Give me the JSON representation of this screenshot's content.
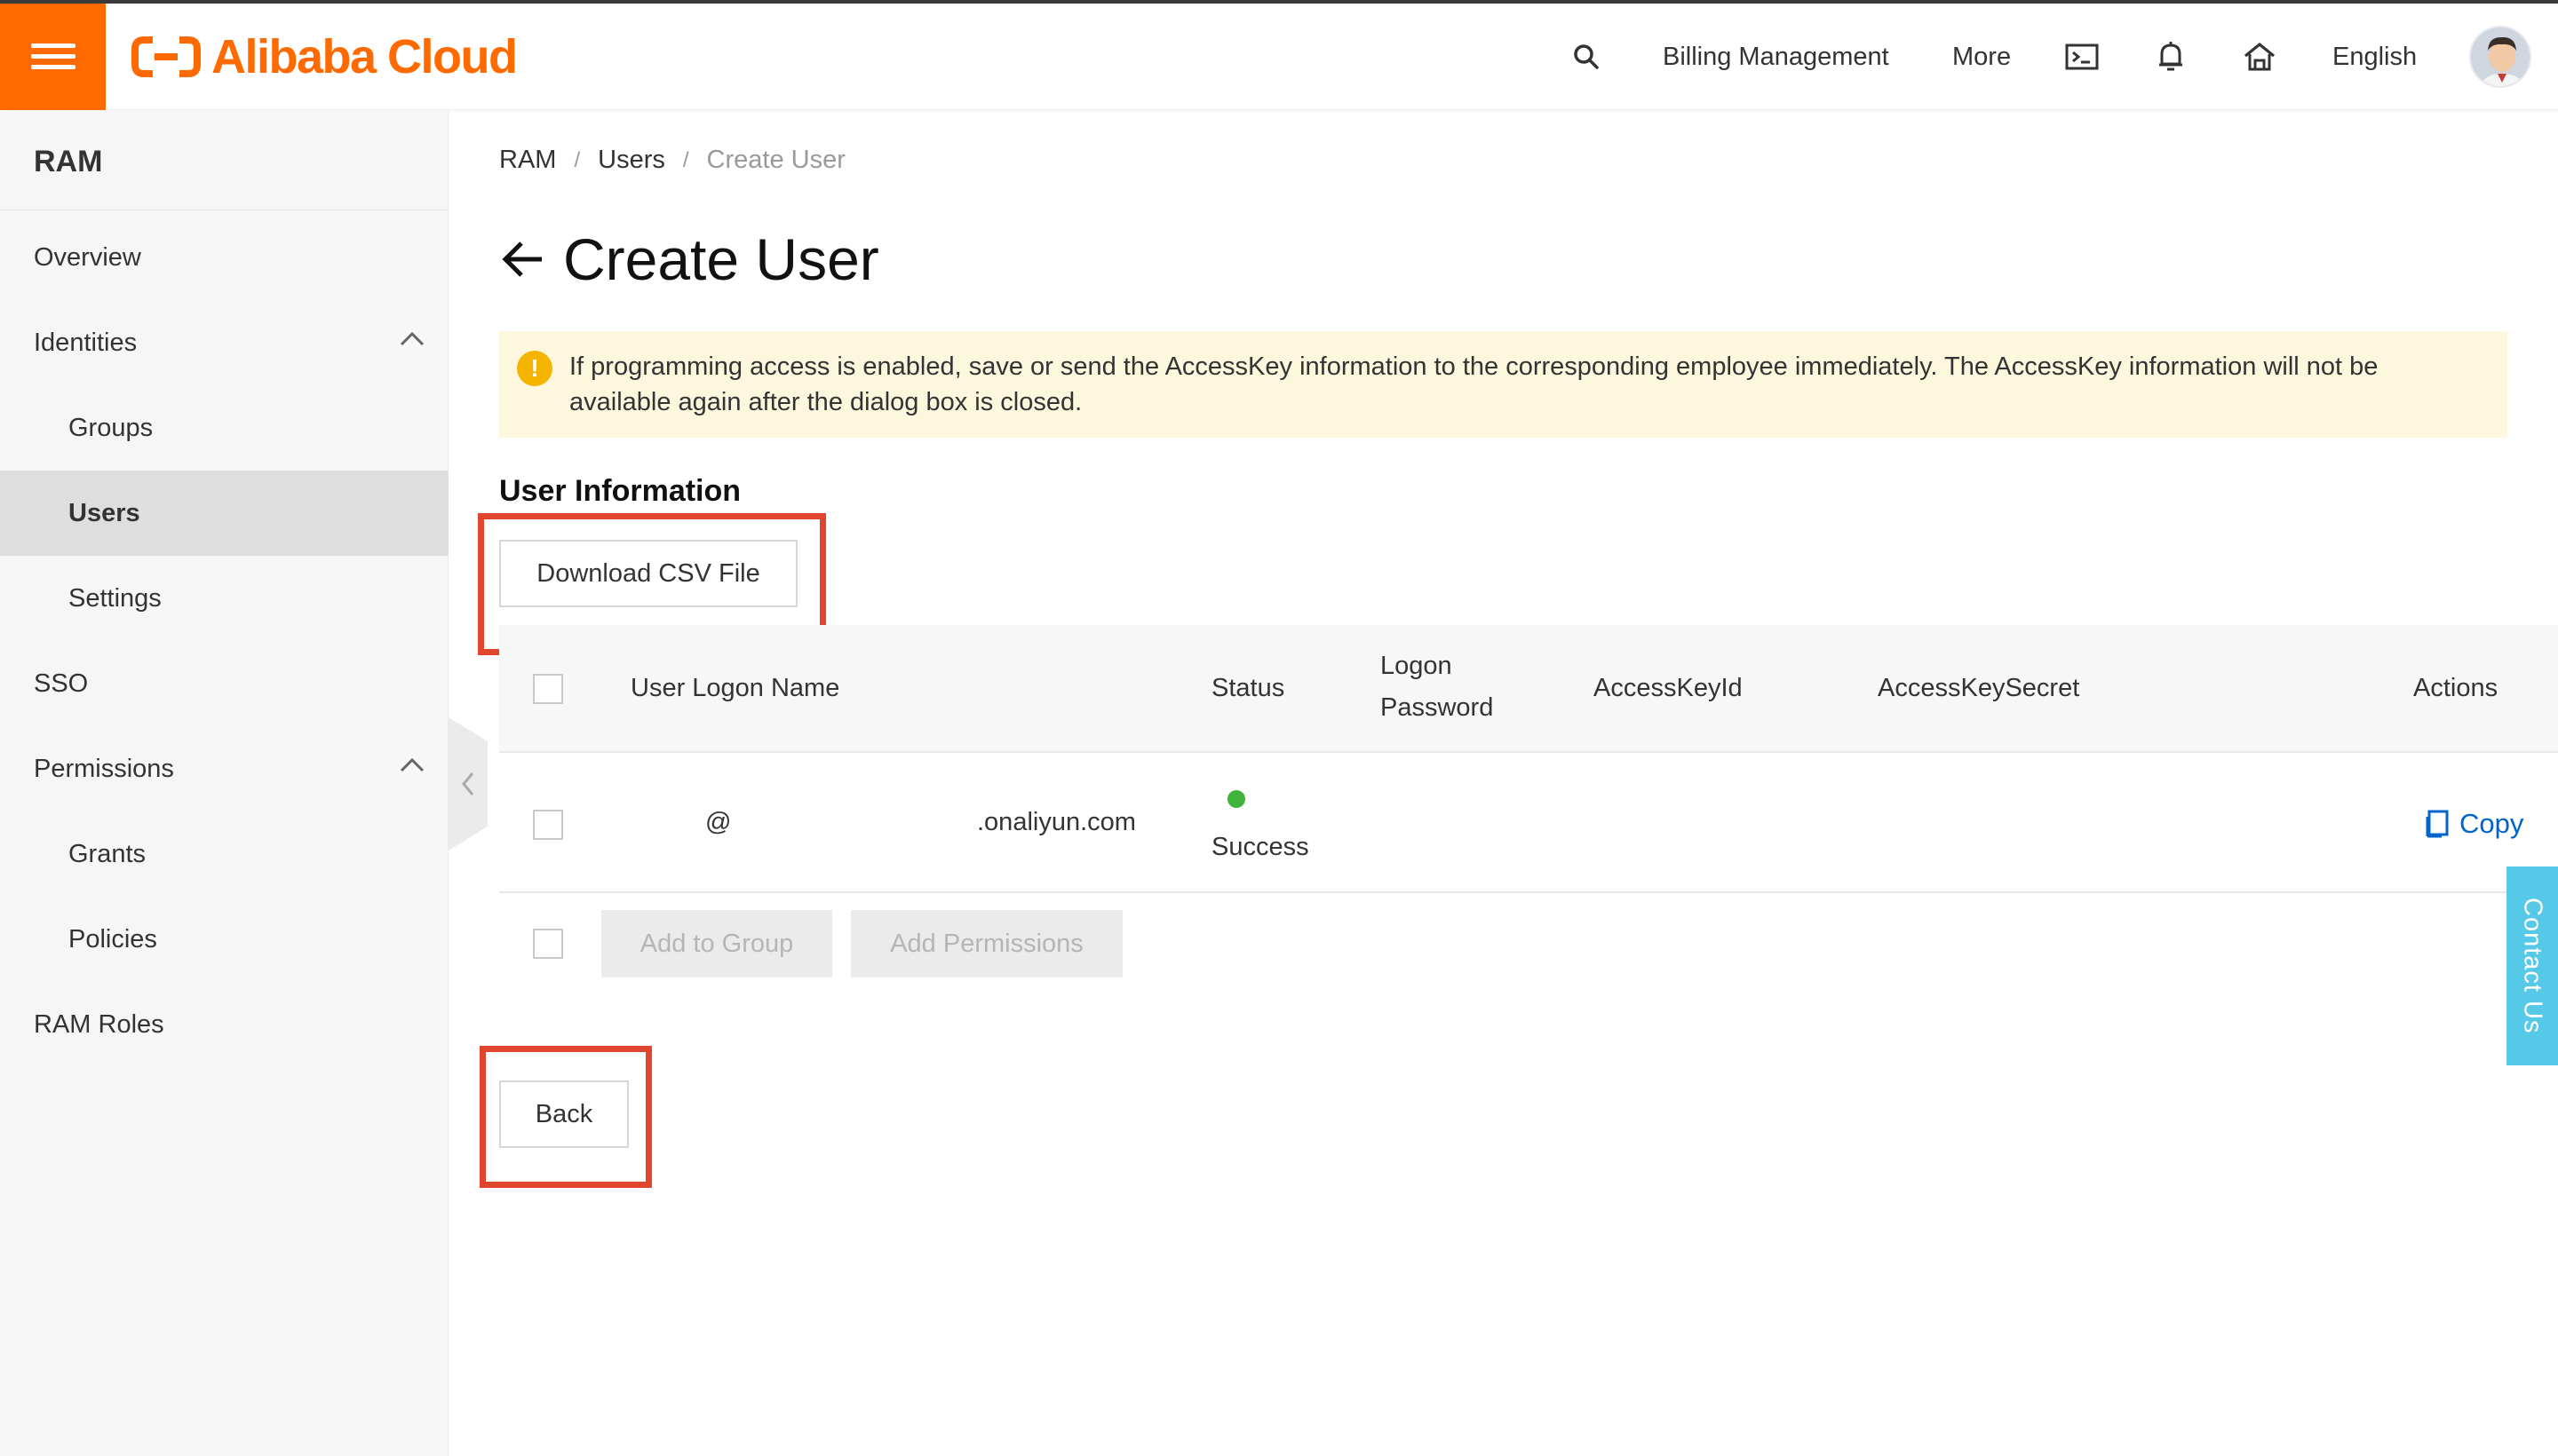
{
  "header": {
    "brand": "Alibaba Cloud",
    "billing_label": "Billing Management",
    "more_label": "More",
    "language_label": "English",
    "accent_color": "#ff6a00"
  },
  "sidebar": {
    "title": "RAM",
    "items": [
      {
        "label": "Overview"
      },
      {
        "label": "Identities"
      },
      {
        "label": "Groups"
      },
      {
        "label": "Users"
      },
      {
        "label": "Settings"
      },
      {
        "label": "SSO"
      },
      {
        "label": "Permissions"
      },
      {
        "label": "Grants"
      },
      {
        "label": "Policies"
      },
      {
        "label": "RAM Roles"
      }
    ]
  },
  "breadcrumb": {
    "items": [
      "RAM",
      "Users",
      "Create User"
    ],
    "separator": "/"
  },
  "page": {
    "title": "Create User"
  },
  "notice": {
    "icon": "warning-icon",
    "text": "If programming access is enabled, save or send the AccessKey information to the corresponding employee immediately. The AccessKey information will not be available again after the dialog box is closed."
  },
  "user_info": {
    "section_title": "User Information",
    "download_label": "Download CSV File",
    "table": {
      "columns": [
        "User Logon Name",
        "Status",
        "Logon Password",
        "AccessKeyId",
        "AccessKeySecret",
        "Actions"
      ],
      "logon_password_lines": [
        "Logon",
        "Password"
      ],
      "rows": [
        {
          "logon_name_at": "@",
          "logon_name_domain": ".onaliyun.com",
          "status": "Success",
          "status_color": "#3eb43a",
          "logon_password": "",
          "access_key_id": "",
          "access_key_secret": "",
          "action": "Copy"
        }
      ]
    },
    "add_to_group_label": "Add to Group",
    "add_permissions_label": "Add Permissions",
    "back_label": "Back"
  },
  "contact": {
    "label": "Contact Us",
    "color": "#56c8e8"
  },
  "annotation_color": "#e0452e"
}
